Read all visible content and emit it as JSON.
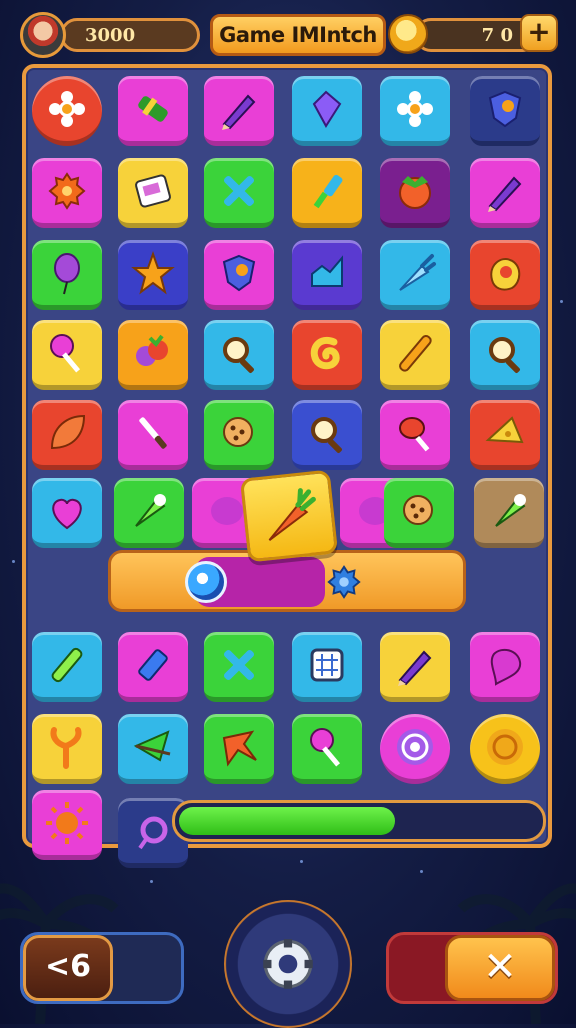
{
  "hud": {
    "score": "3000",
    "title": "Game IMIntch",
    "coins": "7 0",
    "plus_label": "+"
  },
  "board": {
    "rows": [
      [
        {
          "color": "#e8452e",
          "icon": "flower-icon",
          "shape": "round"
        },
        {
          "color": "#e93fd6",
          "icon": "candy-icon"
        },
        {
          "color": "#e93fd6",
          "icon": "pencil-icon"
        },
        {
          "color": "#33b8e8",
          "icon": "gem-icon"
        },
        {
          "color": "#33b8e8",
          "icon": "flower-icon"
        },
        {
          "color": "#2b3b8a",
          "icon": "shield-icon"
        }
      ],
      [
        {
          "color": "#e93fd6",
          "icon": "gear-icon"
        },
        {
          "color": "#f7d23a",
          "icon": "card-icon"
        },
        {
          "color": "#3bd33a",
          "icon": "cross-icon"
        },
        {
          "color": "#f7b21a",
          "icon": "brush-icon"
        },
        {
          "color": "#7a1f8f",
          "icon": "tomato-icon"
        },
        {
          "color": "#e93fd6",
          "icon": "pencil-icon"
        }
      ],
      [
        {
          "color": "#3bd33a",
          "icon": "balloon-icon"
        },
        {
          "color": "#3a3fc8",
          "icon": "star-icon"
        },
        {
          "color": "#e93fd6",
          "icon": "shield-icon"
        },
        {
          "color": "#5a3ad0",
          "icon": "chart-icon"
        },
        {
          "color": "#33b8e8",
          "icon": "carrot-icon"
        },
        {
          "color": "#e8452e",
          "icon": "egg-icon"
        }
      ],
      [
        {
          "color": "#f7d23a",
          "icon": "lollipop-icon"
        },
        {
          "color": "#f7a21a",
          "icon": "fruit-icon"
        },
        {
          "color": "#33b8e8",
          "icon": "magnifier-icon"
        },
        {
          "color": "#e8452e",
          "icon": "swirl-icon"
        },
        {
          "color": "#f7d23a",
          "icon": "stick-icon"
        },
        {
          "color": "#33b8e8",
          "icon": "magnifier-icon"
        }
      ],
      [
        {
          "color": "#e8452e",
          "icon": "leaf-icon"
        },
        {
          "color": "#e93fd6",
          "icon": "knife-icon"
        },
        {
          "color": "#3bd33a",
          "icon": "cookie-icon"
        },
        {
          "color": "#3a4fd0",
          "icon": "magnifier-icon"
        },
        {
          "color": "#e93fd6",
          "icon": "racket-icon"
        },
        {
          "color": "#e8452e",
          "icon": "cheese-icon"
        }
      ]
    ],
    "row6": [
      {
        "color": "#33b8e8",
        "icon": "heart-icon"
      },
      {
        "color": "#3bd33a",
        "icon": "cone-icon"
      },
      {
        "color": "#e93fd6",
        "icon": "blob-icon"
      },
      {
        "color": "#e93fd6",
        "icon": "blob-icon"
      },
      {
        "color": "#3bd33a",
        "icon": "cookie-icon"
      },
      {
        "color": "#b08a5a",
        "icon": "cone-icon"
      }
    ],
    "featured": {
      "icon": "carrot-icon"
    },
    "rows_bottom": [
      [
        {
          "color": "#33b8e8",
          "icon": "marker-icon"
        },
        {
          "color": "#e93fd6",
          "icon": "lighter-icon"
        },
        {
          "color": "#3bd33a",
          "icon": "cross-icon"
        },
        {
          "color": "#33b8e8",
          "icon": "window-icon"
        },
        {
          "color": "#f7d23a",
          "icon": "pencil-icon"
        },
        {
          "color": "#e93fd6",
          "icon": "pin-icon"
        }
      ],
      [
        {
          "color": "#f7d23a",
          "icon": "sprout-icon"
        },
        {
          "color": "#33b8e8",
          "icon": "umbrella-icon"
        },
        {
          "color": "#3bd33a",
          "icon": "bird-icon"
        },
        {
          "color": "#3bd33a",
          "icon": "lollipop-icon"
        },
        {
          "color": "#e93fd6",
          "icon": "spiral-icon",
          "shape": "round"
        },
        {
          "color": "#f7c21a",
          "icon": "coin-icon",
          "shape": "round"
        }
      ],
      [
        {
          "color": "#e93fd6",
          "icon": "sun-icon"
        },
        {
          "color": "#2b3b8a",
          "icon": "ring-icon"
        }
      ]
    ]
  },
  "progress": {
    "value": 0.6
  },
  "controls": {
    "back_label": "<6",
    "close_label": "✕",
    "center_icon": "gear-icon"
  }
}
